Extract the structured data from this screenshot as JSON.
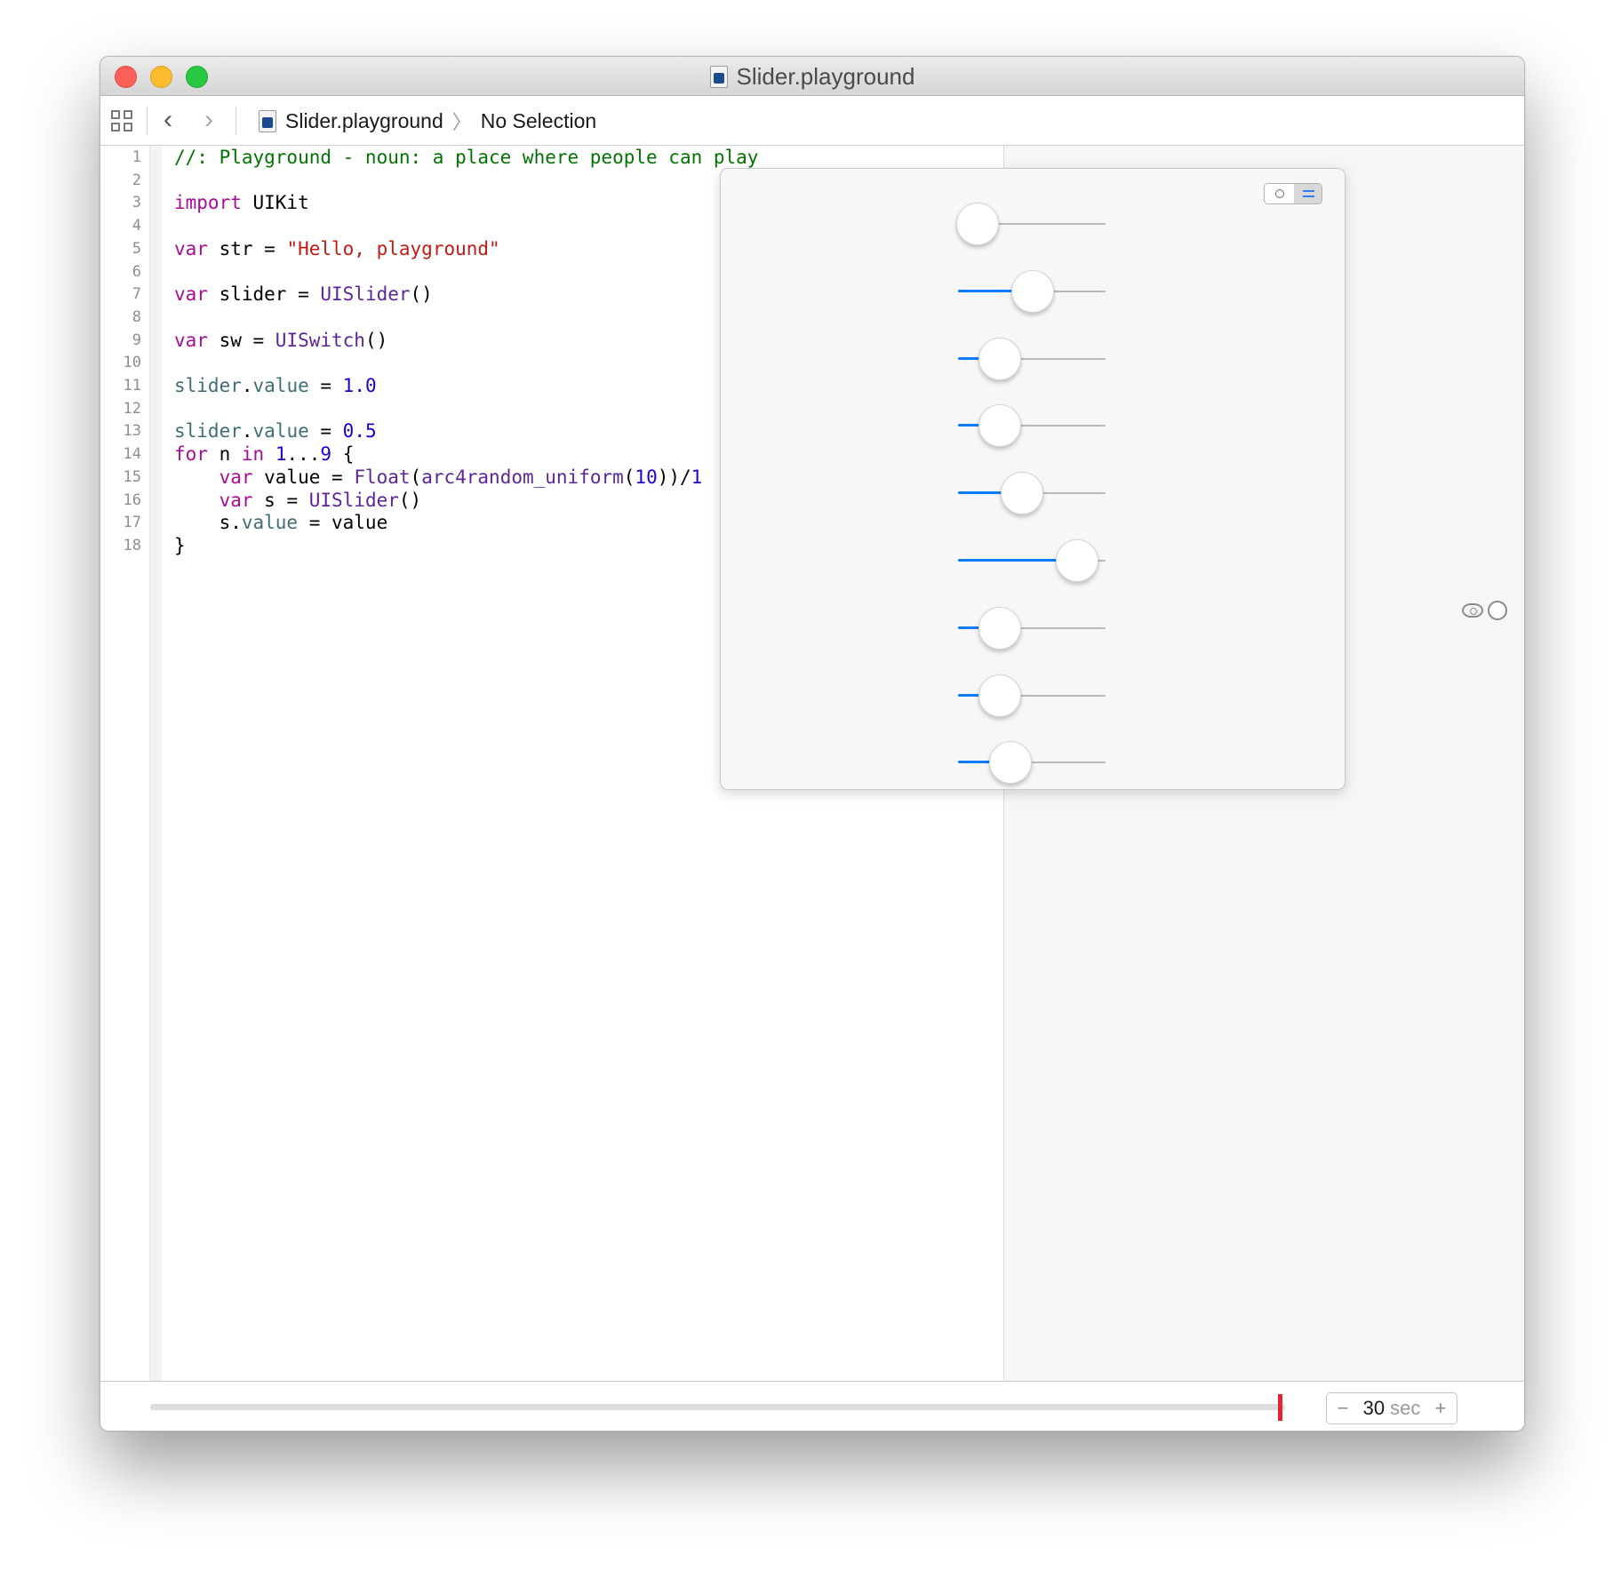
{
  "window": {
    "title": "Slider.playground"
  },
  "jumpbar": {
    "file": "Slider.playground",
    "selection": "No Selection",
    "back_glyph": "‹",
    "forward_glyph": "›",
    "chevron_glyph": "〉"
  },
  "code_lines": [
    {
      "n": "1",
      "tokens": [
        {
          "c": "cm",
          "t": "//: Playground - noun: a place where people can play"
        }
      ]
    },
    {
      "n": "2",
      "tokens": []
    },
    {
      "n": "3",
      "tokens": [
        {
          "c": "kw",
          "t": "import"
        },
        {
          "c": "",
          "t": " UIKit"
        }
      ]
    },
    {
      "n": "4",
      "tokens": []
    },
    {
      "n": "5",
      "tokens": [
        {
          "c": "kw",
          "t": "var"
        },
        {
          "c": "",
          "t": " str = "
        },
        {
          "c": "st",
          "t": "\"Hello, playground\""
        }
      ]
    },
    {
      "n": "6",
      "tokens": []
    },
    {
      "n": "7",
      "tokens": [
        {
          "c": "kw",
          "t": "var"
        },
        {
          "c": "",
          "t": " slider = "
        },
        {
          "c": "ty",
          "t": "UISlider"
        },
        {
          "c": "",
          "t": "()"
        }
      ]
    },
    {
      "n": "8",
      "tokens": []
    },
    {
      "n": "9",
      "tokens": [
        {
          "c": "kw",
          "t": "var"
        },
        {
          "c": "",
          "t": " sw = "
        },
        {
          "c": "ty",
          "t": "UISwitch"
        },
        {
          "c": "",
          "t": "()"
        }
      ]
    },
    {
      "n": "10",
      "tokens": []
    },
    {
      "n": "11",
      "tokens": [
        {
          "c": "pr",
          "t": "slider"
        },
        {
          "c": "",
          "t": "."
        },
        {
          "c": "pr",
          "t": "value"
        },
        {
          "c": "",
          "t": " = "
        },
        {
          "c": "nm",
          "t": "1.0"
        }
      ]
    },
    {
      "n": "12",
      "tokens": []
    },
    {
      "n": "13",
      "tokens": [
        {
          "c": "pr",
          "t": "slider"
        },
        {
          "c": "",
          "t": "."
        },
        {
          "c": "pr",
          "t": "value"
        },
        {
          "c": "",
          "t": " = "
        },
        {
          "c": "nm",
          "t": "0.5"
        }
      ]
    },
    {
      "n": "14",
      "tokens": [
        {
          "c": "kw",
          "t": "for"
        },
        {
          "c": "",
          "t": " n "
        },
        {
          "c": "kw",
          "t": "in"
        },
        {
          "c": "",
          "t": " "
        },
        {
          "c": "nm",
          "t": "1"
        },
        {
          "c": "",
          "t": "..."
        },
        {
          "c": "nm",
          "t": "9"
        },
        {
          "c": "",
          "t": " {"
        }
      ]
    },
    {
      "n": "15",
      "tokens": [
        {
          "c": "",
          "t": "    "
        },
        {
          "c": "kw",
          "t": "var"
        },
        {
          "c": "",
          "t": " value = "
        },
        {
          "c": "ty",
          "t": "Float"
        },
        {
          "c": "",
          "t": "("
        },
        {
          "c": "ty",
          "t": "arc4random_uniform"
        },
        {
          "c": "",
          "t": "("
        },
        {
          "c": "nm",
          "t": "10"
        },
        {
          "c": "",
          "t": "))/"
        },
        {
          "c": "nm",
          "t": "1"
        }
      ]
    },
    {
      "n": "16",
      "tokens": [
        {
          "c": "",
          "t": "    "
        },
        {
          "c": "kw",
          "t": "var"
        },
        {
          "c": "",
          "t": " s = "
        },
        {
          "c": "ty",
          "t": "UISlider"
        },
        {
          "c": "",
          "t": "()"
        }
      ]
    },
    {
      "n": "17",
      "tokens": [
        {
          "c": "",
          "t": "    s."
        },
        {
          "c": "pr",
          "t": "value"
        },
        {
          "c": "",
          "t": " = value"
        }
      ]
    },
    {
      "n": "18",
      "tokens": [
        {
          "c": "",
          "t": "}"
        }
      ]
    }
  ],
  "sliders": [
    0.0,
    0.5,
    0.2,
    0.2,
    0.4,
    0.9,
    0.2,
    0.2,
    0.3
  ],
  "stepper": {
    "minus": "−",
    "value": "30",
    "unit": "sec",
    "plus": "+"
  },
  "colors": {
    "slider_fill": "#0a7afe",
    "timeline_marker": "#e8232d"
  }
}
